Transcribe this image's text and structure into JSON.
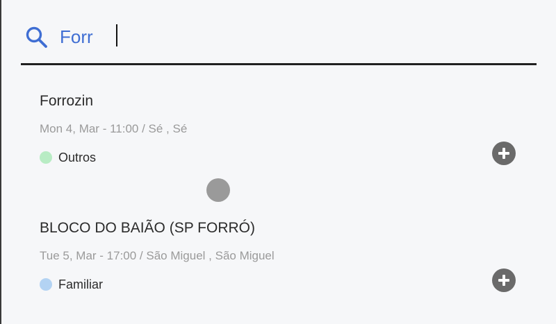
{
  "search": {
    "query": "Forr"
  },
  "events": [
    {
      "title": "Forrozin",
      "meta": "Mon 4, Mar - 11:00 / Sé , Sé",
      "category": "Outros",
      "category_color": "#b8ecc4"
    },
    {
      "title": "BLOCO DO BAIÃO (SP FORRÓ)",
      "meta": "Tue 5, Mar - 17:00 / São Miguel , São Miguel",
      "category": "Familiar",
      "category_color": "#b3d3f3"
    }
  ],
  "colors": {
    "accent": "#3f6ed3",
    "add_button": "#6a6a6a"
  },
  "icons": {
    "search": "search-icon",
    "add": "plus-circle-icon"
  }
}
